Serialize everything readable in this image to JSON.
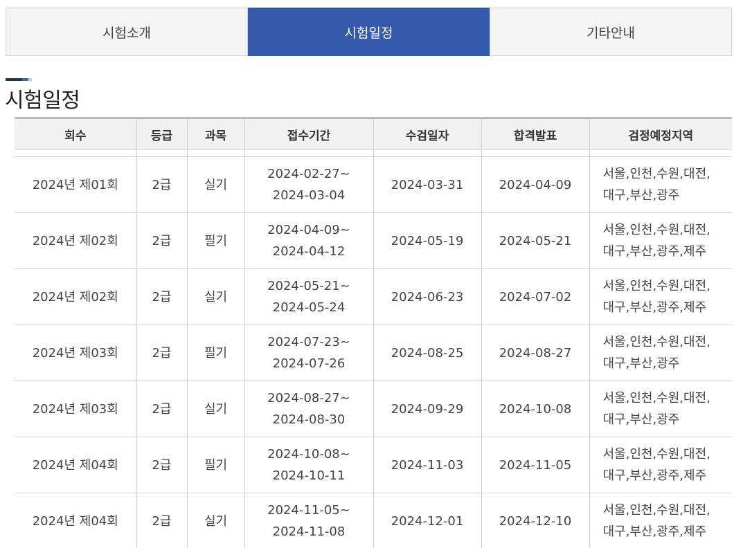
{
  "tabs": [
    {
      "label": "시험소개"
    },
    {
      "label": "시험일정"
    },
    {
      "label": "기타안내"
    }
  ],
  "active_tab": 1,
  "section": {
    "title": "시험일정"
  },
  "table": {
    "headers": [
      "회수",
      "등급",
      "과목",
      "접수기간",
      "수검일자",
      "합격발표",
      "검정예정지역"
    ],
    "rows": [
      {
        "round": "2024년 제01회",
        "grade": "2급",
        "subject": "실기",
        "reg_start": "2024-02-27~",
        "reg_end": "2024-03-04",
        "exam_date": "2024-03-31",
        "result_date": "2024-04-09",
        "region_1": "서울,인천,수원,대전,",
        "region_2": "대구,부산,광주"
      },
      {
        "round": "2024년 제02회",
        "grade": "2급",
        "subject": "필기",
        "reg_start": "2024-04-09~",
        "reg_end": "2024-04-12",
        "exam_date": "2024-05-19",
        "result_date": "2024-05-21",
        "region_1": "서울,인천,수원,대전,",
        "region_2": "대구,부산,광주,제주"
      },
      {
        "round": "2024년 제02회",
        "grade": "2급",
        "subject": "실기",
        "reg_start": "2024-05-21~",
        "reg_end": "2024-05-24",
        "exam_date": "2024-06-23",
        "result_date": "2024-07-02",
        "region_1": "서울,인천,수원,대전,",
        "region_2": "대구,부산,광주,제주"
      },
      {
        "round": "2024년 제03회",
        "grade": "2급",
        "subject": "필기",
        "reg_start": "2024-07-23~",
        "reg_end": "2024-07-26",
        "exam_date": "2024-08-25",
        "result_date": "2024-08-27",
        "region_1": "서울,인천,수원,대전,",
        "region_2": "대구,부산,광주"
      },
      {
        "round": "2024년 제03회",
        "grade": "2급",
        "subject": "실기",
        "reg_start": "2024-08-27~",
        "reg_end": "2024-08-30",
        "exam_date": "2024-09-29",
        "result_date": "2024-10-08",
        "region_1": "서울,인천,수원,대전,",
        "region_2": "대구,부산,광주"
      },
      {
        "round": "2024년 제04회",
        "grade": "2급",
        "subject": "필기",
        "reg_start": "2024-10-08~",
        "reg_end": "2024-10-11",
        "exam_date": "2024-11-03",
        "result_date": "2024-11-05",
        "region_1": "서울,인천,수원,대전,",
        "region_2": "대구,부산,광주,제주"
      },
      {
        "round": "2024년 제04회",
        "grade": "2급",
        "subject": "실기",
        "reg_start": "2024-11-05~",
        "reg_end": "2024-11-08",
        "exam_date": "2024-12-01",
        "result_date": "2024-12-10",
        "region_1": "서울,인천,수원,대전,",
        "region_2": "대구,부산,광주,제주"
      }
    ]
  },
  "colors": {
    "active_tab_bg": "#3459ab",
    "tab_bg": "#f3f3f3",
    "header_bg": "#f1f1f1",
    "border": "#cfcfcf"
  }
}
